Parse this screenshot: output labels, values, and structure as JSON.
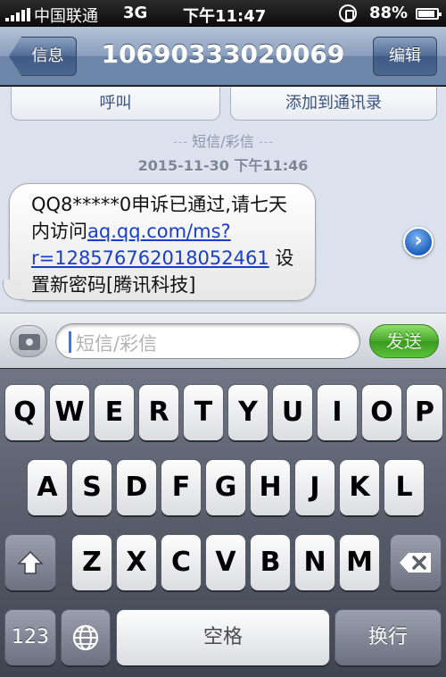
{
  "status_bar": {
    "carrier": "中国联通",
    "network": "3G",
    "time": "下午11:47",
    "battery": "88%"
  },
  "nav": {
    "back_label": "信息",
    "title": "10690333020069",
    "edit_label": "编辑"
  },
  "contact_actions": {
    "call_label": "呼叫",
    "add_contact_label": "添加到通讯录"
  },
  "message": {
    "type_label": "短信/彩信",
    "timestamp": "2015-11-30 下午11:46",
    "text_before_link": "QQ8*****0申诉已通过,请七天内访问",
    "link": "aq.qq.com/ms?r=128576762018052461",
    "text_after_link": " 设置新密码[腾讯科技]"
  },
  "composer": {
    "placeholder": "短信/彩信",
    "send_label": "发送"
  },
  "keyboard": {
    "row1": [
      "Q",
      "W",
      "E",
      "R",
      "T",
      "Y",
      "U",
      "I",
      "O",
      "P"
    ],
    "row2": [
      "A",
      "S",
      "D",
      "F",
      "G",
      "H",
      "J",
      "K",
      "L"
    ],
    "row3": [
      "Z",
      "X",
      "C",
      "V",
      "B",
      "N",
      "M"
    ],
    "numbers_label": "123",
    "space_label": "空格",
    "return_label": "换行",
    "icons": [
      "shift-icon",
      "delete-icon",
      "globe-icon",
      "camera-icon",
      "forward-arrow-icon"
    ]
  },
  "colors": {
    "nav_bar": "#6d87aa",
    "conversation_bg": "#dbe2ed",
    "send_button": "#47a82a",
    "link": "#1a3fc7"
  }
}
